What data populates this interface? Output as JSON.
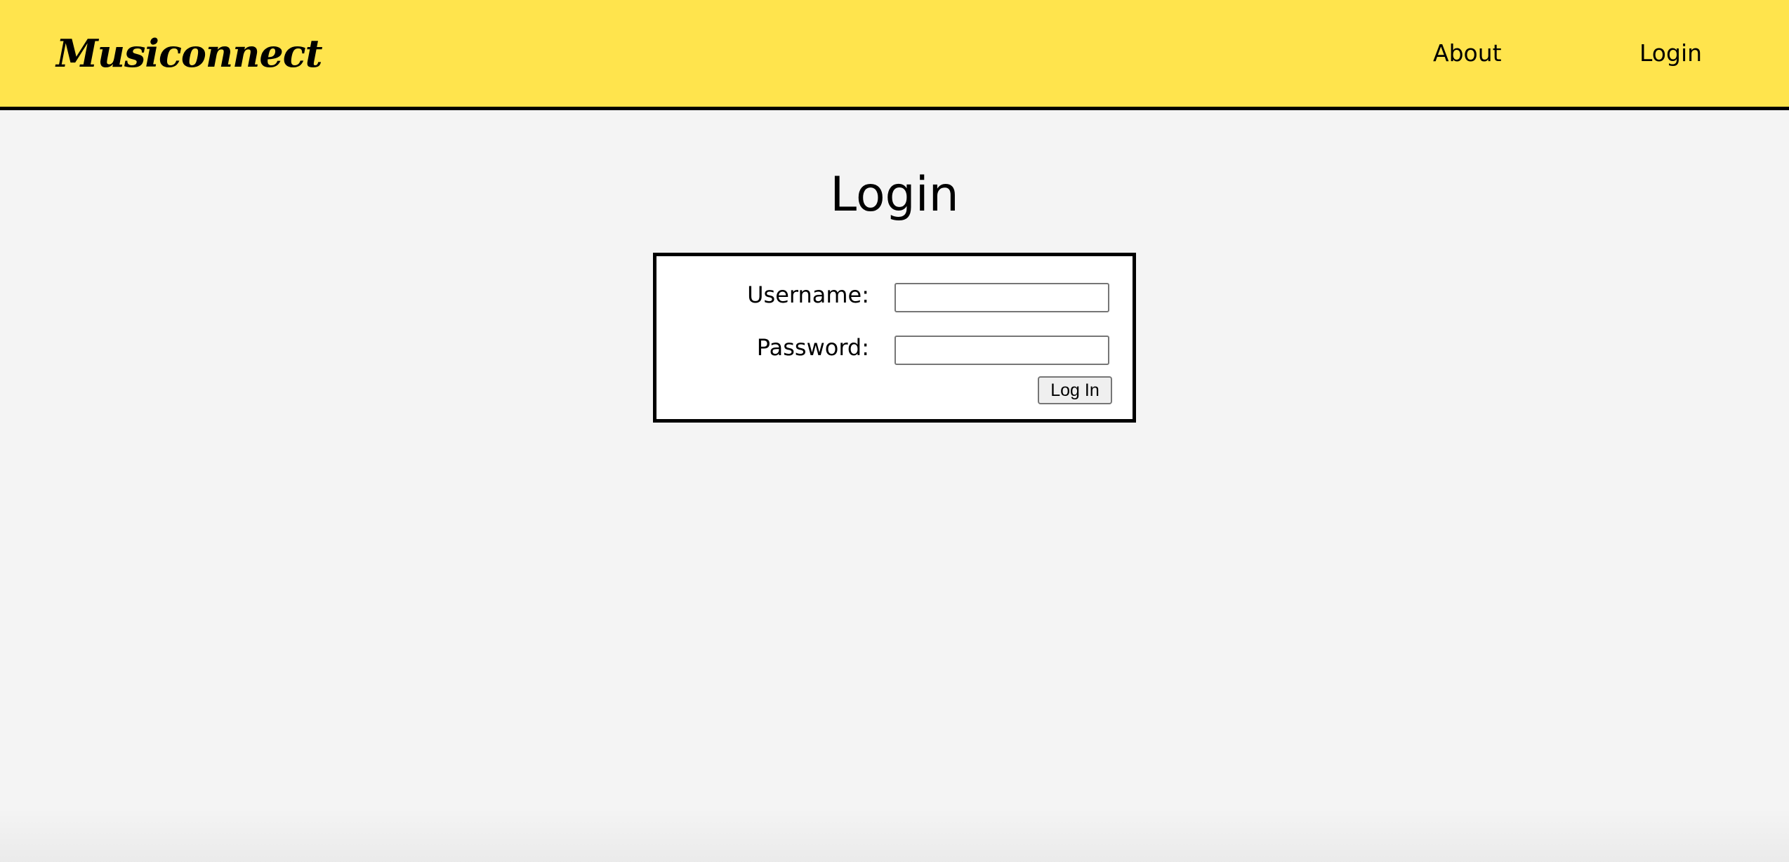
{
  "header": {
    "logo": "Musiconnect",
    "nav": {
      "about": "About",
      "login": "Login"
    },
    "background_color": "#ffe44d"
  },
  "main": {
    "title": "Login",
    "form": {
      "username_label": "Username:",
      "username_value": "",
      "password_label": "Password:",
      "password_value": "",
      "submit_label": "Log In"
    }
  },
  "colors": {
    "page_background": "#f4f4f4",
    "header_border": "#000000",
    "form_background": "#ffffff"
  }
}
